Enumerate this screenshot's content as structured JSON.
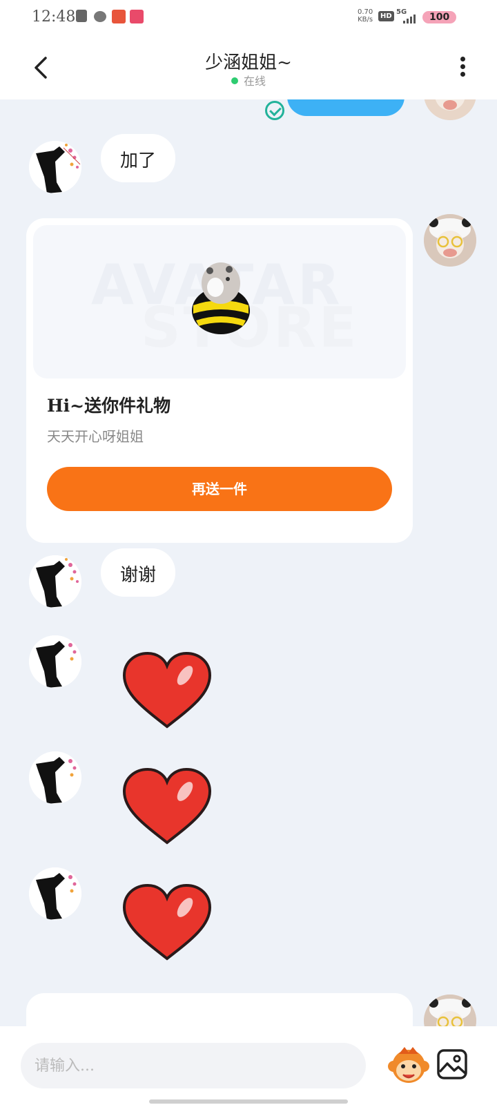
{
  "status_bar": {
    "time": "12:48",
    "network_speed": "0.70",
    "network_unit": "KB/s",
    "hd": "HD",
    "signal": "5G",
    "battery": "100"
  },
  "header": {
    "title": "少涵姐姐~",
    "status": "在线"
  },
  "messages": {
    "top_sent_partial": "",
    "reply_1": "加了",
    "gift": {
      "watermark_line1": "AVATAR",
      "watermark_line2": "STORE",
      "title": "Hi~送你件礼物",
      "subtitle": "天天开心呀姐姐",
      "button": "再送一件"
    },
    "reply_2": "谢谢"
  },
  "input": {
    "placeholder": "请输入..."
  },
  "colors": {
    "accent_orange": "#f97316",
    "bubble_blue": "#3db1f5",
    "online_green": "#2ecc71",
    "heart_red": "#e8352c"
  }
}
